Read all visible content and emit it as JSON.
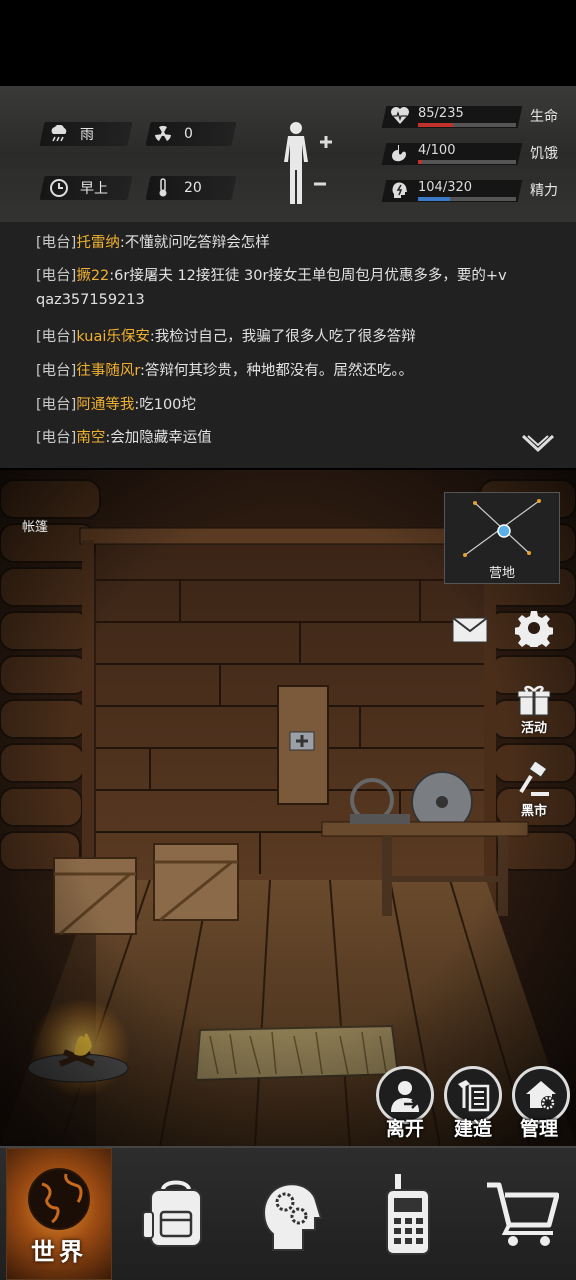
{
  "status": {
    "weather": {
      "icon": "rain-cloud-icon",
      "label": "雨"
    },
    "radiation": {
      "icon": "radiation-icon",
      "value": "0"
    },
    "time": {
      "icon": "clock-icon",
      "label": "早上"
    },
    "temperature": {
      "icon": "thermometer-icon",
      "value": "20"
    },
    "body_icon": "body-figure-icon",
    "stats": [
      {
        "icon": "heart-pulse-icon",
        "value": "85/235",
        "label": "生命",
        "fraction": 0.36,
        "color": "#c0322a"
      },
      {
        "icon": "stomach-icon",
        "value": "4/100",
        "label": "饥饿",
        "fraction": 0.04,
        "color": "#c0322a"
      },
      {
        "icon": "energy-head-icon",
        "value": "104/320",
        "label": "精力",
        "fraction": 0.325,
        "color": "#3a7ac8"
      }
    ]
  },
  "chat": {
    "lines": [
      {
        "tag": "[电台]",
        "name": "托雷纳",
        "msg": ":不懂就问吃答辩会怎样"
      },
      {
        "tag": "[电台]",
        "name": "撅22",
        "msg": ":6r接屠夫 12接狂徒 30r接女王单包周包月优惠多多，要的+v"
      },
      {
        "tag": "",
        "name": "",
        "msg": "qaz357159213"
      },
      {
        "tag": "[电台]",
        "name": "kuai乐保安",
        "msg": ":我检讨自己，我骗了很多人吃了很多答辩"
      },
      {
        "tag": "[电台]",
        "name": "往事随风r",
        "msg": ":答辩何其珍贵，种地都没有。居然还吃。。"
      },
      {
        "tag": "[电台]",
        "name": "阿通等我",
        "msg": ":吃100坨"
      },
      {
        "tag": "[电台]",
        "name": "南空",
        "msg": ":会加隐藏幸运值"
      }
    ],
    "toggle_icon": "chevron-down-icon"
  },
  "scene": {
    "location": "帐篷",
    "minimap_label": "营地"
  },
  "side": {
    "mail_icon": "mail-icon",
    "settings_icon": "gear-icon",
    "events_label": "活动",
    "black_market_label": "黑市"
  },
  "actions": {
    "leave": "离开",
    "build": "建造",
    "manage": "管理"
  },
  "nav": {
    "world": "世界",
    "items": [
      "backpack-icon",
      "head-gears-icon",
      "radio-icon",
      "cart-icon"
    ]
  }
}
